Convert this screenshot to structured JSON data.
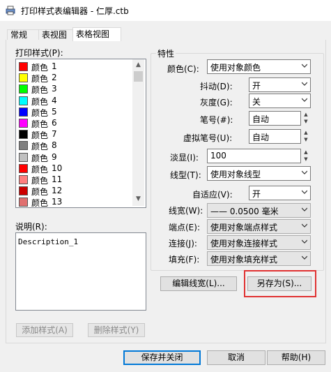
{
  "window": {
    "title": "打印样式表编辑器 - 仁厚.ctb"
  },
  "tabs": [
    {
      "label": "常规"
    },
    {
      "label": "表视图"
    },
    {
      "label": "表格视图"
    }
  ],
  "styles_panel": {
    "label": "打印样式(P):",
    "items": [
      {
        "name": "颜色",
        "num": "1",
        "color": "#ff0000"
      },
      {
        "name": "颜色",
        "num": "2",
        "color": "#ffff00"
      },
      {
        "name": "颜色",
        "num": "3",
        "color": "#00ff00"
      },
      {
        "name": "颜色",
        "num": "4",
        "color": "#00ffff"
      },
      {
        "name": "颜色",
        "num": "5",
        "color": "#0000ff"
      },
      {
        "name": "颜色",
        "num": "6",
        "color": "#ff00ff"
      },
      {
        "name": "颜色",
        "num": "7",
        "color": "#000000"
      },
      {
        "name": "颜色",
        "num": "8",
        "color": "#808080"
      },
      {
        "name": "颜色",
        "num": "9",
        "color": "#c0c0c0"
      },
      {
        "name": "颜色",
        "num": "10",
        "color": "#ff0000"
      },
      {
        "name": "颜色",
        "num": "11",
        "color": "#ff7f7f"
      },
      {
        "name": "颜色",
        "num": "12",
        "color": "#cc0000"
      },
      {
        "name": "颜色",
        "num": "13",
        "color": "#e07070"
      }
    ]
  },
  "description": {
    "label": "说明(R):",
    "value": "Description_1"
  },
  "buttons": {
    "add_style": "添加样式(A)",
    "delete_style": "删除样式(Y)",
    "edit_lineweight": "编辑线宽(L)...",
    "save_as": "另存为(S)...",
    "save_close": "保存并关闭",
    "cancel": "取消",
    "help": "帮助(H)"
  },
  "properties": {
    "title": "特性",
    "color": {
      "label": "颜色(C):",
      "value": "使用对象颜色"
    },
    "dither": {
      "label": "抖动(D):",
      "value": "开"
    },
    "grayscale": {
      "label": "灰度(G):",
      "value": "关"
    },
    "pen": {
      "label": "笔号(#):",
      "value": "自动"
    },
    "virtual_pen": {
      "label": "虚拟笔号(U):",
      "value": "自动"
    },
    "screening": {
      "label": "淡显(I):",
      "value": "100"
    },
    "linetype": {
      "label": "线型(T):",
      "value": "使用对象线型"
    },
    "adaptive": {
      "label": "自适应(V):",
      "value": "开"
    },
    "lineweight": {
      "label": "线宽(W):",
      "value": "—— 0.0500 毫米"
    },
    "line_end": {
      "label": "端点(E):",
      "value": "使用对象端点样式"
    },
    "line_join": {
      "label": "连接(J):",
      "value": "使用对象连接样式"
    },
    "fill": {
      "label": "填充(F):",
      "value": "使用对象填充样式"
    }
  }
}
